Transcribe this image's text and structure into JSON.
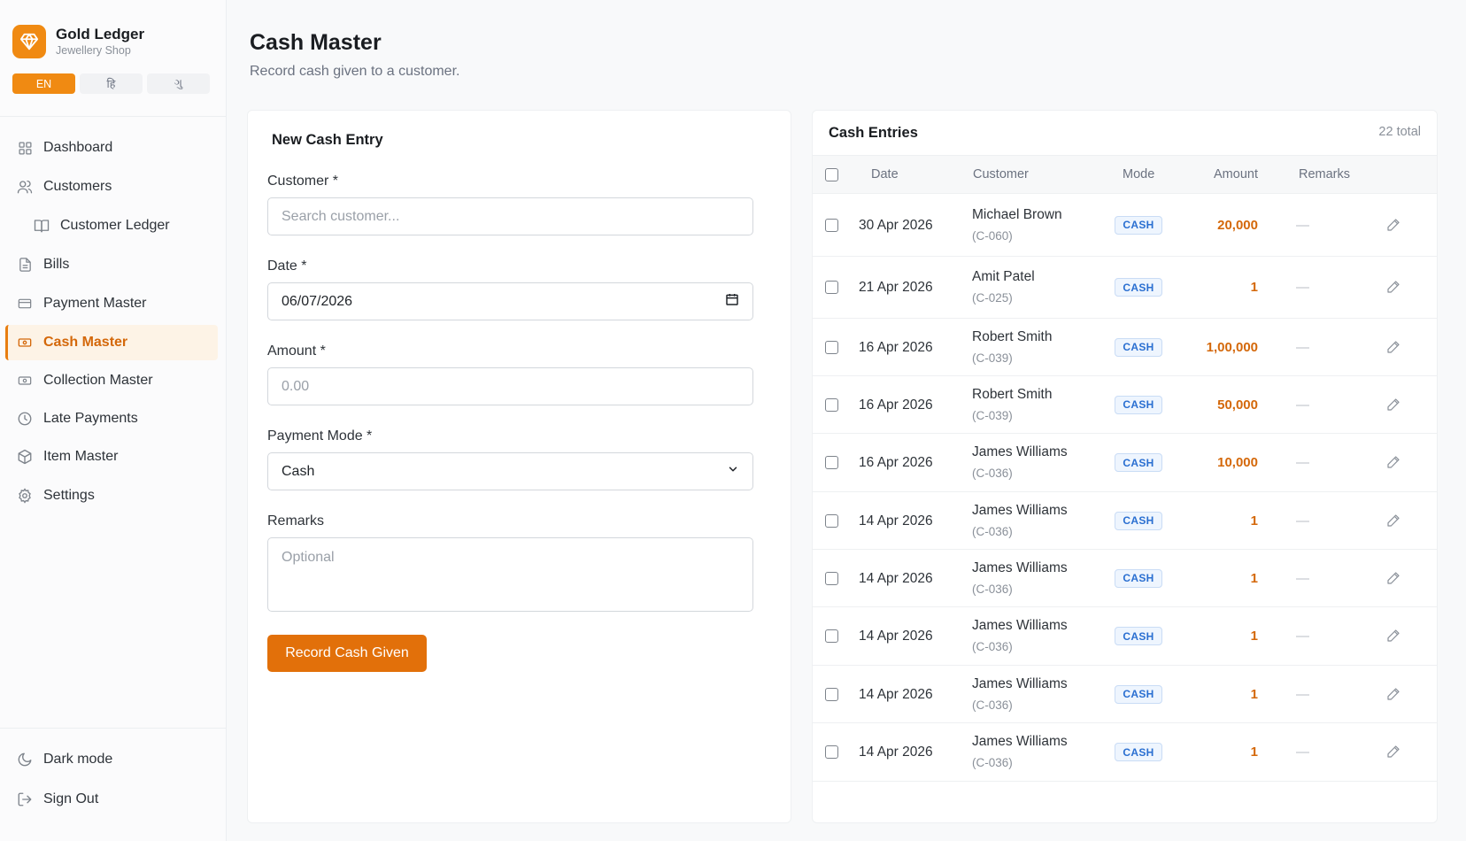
{
  "brand": {
    "title": "Gold Ledger",
    "subtitle": "Jewellery Shop"
  },
  "languages": [
    {
      "label": "EN",
      "active": true
    },
    {
      "label": "हि",
      "active": false
    },
    {
      "label": "ગુ",
      "active": false
    }
  ],
  "nav": {
    "items": [
      {
        "label": "Dashboard",
        "icon": "grid-icon"
      },
      {
        "label": "Customers",
        "icon": "users-icon"
      },
      {
        "label": "Customer Ledger",
        "icon": "book-icon"
      },
      {
        "label": "Bills",
        "icon": "file-icon"
      },
      {
        "label": "Payment Master",
        "icon": "card-icon"
      },
      {
        "label": "Cash Master",
        "icon": "cash-icon",
        "active": true
      },
      {
        "label": "Collection Master",
        "icon": "cash-icon"
      },
      {
        "label": "Late Payments",
        "icon": "clock-icon"
      },
      {
        "label": "Item Master",
        "icon": "box-icon"
      },
      {
        "label": "Settings",
        "icon": "gear-icon"
      }
    ],
    "footer": [
      {
        "label": "Dark mode",
        "icon": "moon-icon"
      },
      {
        "label": "Sign Out",
        "icon": "logout-icon"
      }
    ]
  },
  "page": {
    "title": "Cash Master",
    "subtitle": "Record cash given to a customer."
  },
  "form": {
    "title": "New Cash Entry",
    "customer": {
      "label": "Customer *",
      "placeholder": "Search customer..."
    },
    "date": {
      "label": "Date *",
      "value": "06/07/2026"
    },
    "amount": {
      "label": "Amount *",
      "placeholder": "0.00"
    },
    "mode": {
      "label": "Payment Mode *",
      "value": "Cash"
    },
    "remarks": {
      "label": "Remarks",
      "placeholder": "Optional"
    },
    "submit_label": "Record Cash Given"
  },
  "table": {
    "title": "Cash Entries",
    "total": "22 total",
    "columns": {
      "date": "Date",
      "customer": "Customer",
      "mode": "Mode",
      "amount": "Amount",
      "remarks": "Remarks"
    },
    "rows": [
      {
        "date": "30 Apr 2026",
        "name": "Michael Brown",
        "code": "(C-060)",
        "mode": "CASH",
        "amount": "20,000",
        "remarks": "—"
      },
      {
        "date": "21 Apr 2026",
        "name": "Amit Patel",
        "code": "(C-025)",
        "mode": "CASH",
        "amount": "1",
        "remarks": "—"
      },
      {
        "date": "16 Apr 2026",
        "name": "Robert Smith",
        "code": "(C-039)",
        "mode": "CASH",
        "amount": "1,00,000",
        "remarks": "—"
      },
      {
        "date": "16 Apr 2026",
        "name": "Robert Smith",
        "code": "(C-039)",
        "mode": "CASH",
        "amount": "50,000",
        "remarks": "—"
      },
      {
        "date": "16 Apr 2026",
        "name": "James Williams",
        "code": "(C-036)",
        "mode": "CASH",
        "amount": "10,000",
        "remarks": "—"
      },
      {
        "date": "14 Apr 2026",
        "name": "James Williams",
        "code": "(C-036)",
        "mode": "CASH",
        "amount": "1",
        "remarks": "—"
      },
      {
        "date": "14 Apr 2026",
        "name": "James Williams",
        "code": "(C-036)",
        "mode": "CASH",
        "amount": "1",
        "remarks": "—"
      },
      {
        "date": "14 Apr 2026",
        "name": "James Williams",
        "code": "(C-036)",
        "mode": "CASH",
        "amount": "1",
        "remarks": "—"
      },
      {
        "date": "14 Apr 2026",
        "name": "James Williams",
        "code": "(C-036)",
        "mode": "CASH",
        "amount": "1",
        "remarks": "—"
      },
      {
        "date": "14 Apr 2026",
        "name": "James Williams",
        "code": "(C-036)",
        "mode": "CASH",
        "amount": "1",
        "remarks": "—"
      }
    ]
  },
  "colors": {
    "accent": "#e2700a",
    "brand": "#f08a12",
    "badge_blue": "#2a6fd1"
  }
}
